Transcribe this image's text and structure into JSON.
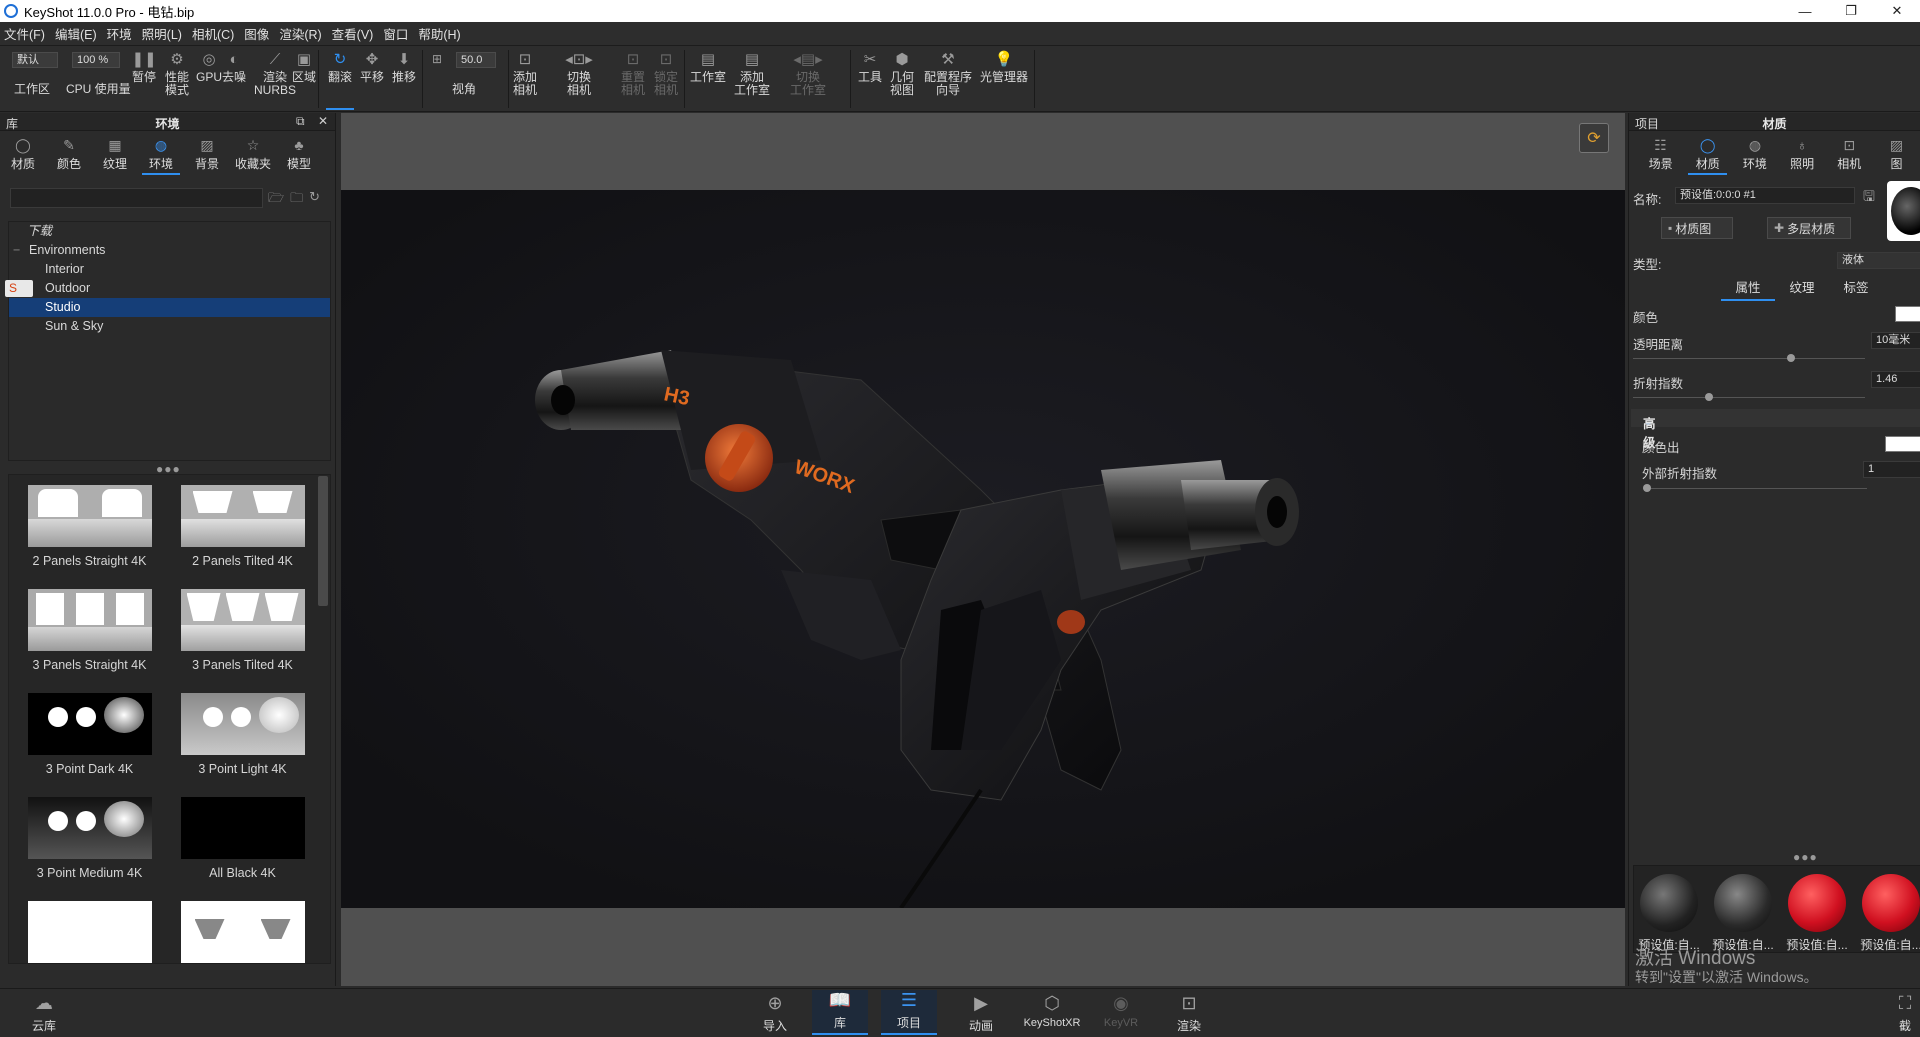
{
  "titlebar": {
    "title": "KeyShot 11.0.0 Pro  - 电钻.bip",
    "minimize": "—",
    "restore": "❐",
    "close": "✕"
  },
  "menu": [
    "文件(F)",
    "编辑(E)",
    "环境",
    "照明(L)",
    "相机(C)",
    "图像",
    "渲染(R)",
    "查看(V)",
    "窗口",
    "帮助(H)"
  ],
  "toolbar": {
    "workspace_select": "默认",
    "workspace_label": "工作区",
    "cpu_value": "100 %",
    "cpu_label": "CPU 使用量",
    "pause_label": "暂停",
    "perf_label": "性能\n模式",
    "gpu_label": "GPU",
    "denoise_label": "去噪",
    "nurbs_label": "渲染\nNURBS",
    "region_label": "区域",
    "tumble_label": "翻滚",
    "pan_label": "平移",
    "dolly_label": "推移",
    "fov_value": "50.0",
    "fov_label": "视角",
    "add_camera_label": "添加\n相机",
    "switch_camera_label": "切换\n相机",
    "reset_camera_label": "重置\n相机",
    "lock_camera_label": "锁定\n相机",
    "studio_label": "工作室",
    "add_studio_label": "添加\n工作室",
    "switch_studio_label": "切换\n工作室",
    "tools_label": "工具",
    "geometry_view_label": "几何\n视图",
    "config_wizard_label": "配置程序\n向导",
    "light_manager_label": "光管理器"
  },
  "library": {
    "panel_title": "库",
    "section_title": "环境",
    "tabs": [
      "材质",
      "颜色",
      "纹理",
      "环境",
      "背景",
      "收藏夹",
      "模型"
    ],
    "active_tab": "环境",
    "search_placeholder": "",
    "tree": [
      {
        "label": "下载",
        "level": 1,
        "italic": true
      },
      {
        "label": "Environments",
        "level": 1
      },
      {
        "label": "Interior",
        "level": 2
      },
      {
        "label": "Outdoor",
        "level": 2
      },
      {
        "label": "Studio",
        "level": 2,
        "selected": true
      },
      {
        "label": "Sun & Sky",
        "level": 2
      }
    ],
    "thumbnails": [
      "2 Panels Straight 4K",
      "2 Panels Tilted 4K",
      "3 Panels Straight 4K",
      "3 Panels Tilted 4K",
      "3 Point Dark 4K",
      "3 Point Light 4K",
      "3 Point Medium 4K",
      "All Black 4K",
      "",
      ""
    ]
  },
  "project": {
    "panel_title": "项目",
    "section_title": "材质",
    "tabs": [
      "场景",
      "材质",
      "环境",
      "照明",
      "相机",
      "图"
    ],
    "active_tab": "材质",
    "name_label": "名称:",
    "name_value": "预设值:0:0:0 #1",
    "material_graph_btn": "材质图",
    "multi_material_btn": "多层材质",
    "type_label": "类型:",
    "type_value": "液体",
    "subtabs": [
      "属性",
      "纹理",
      "标签"
    ],
    "active_subtab": "属性",
    "color_label": "颜色",
    "transparency_distance_label": "透明距离",
    "transparency_distance_value": "10毫米",
    "ior_label": "折射指数",
    "ior_value": "1.46",
    "advanced_label": "高级",
    "color_out_label": "颜色出",
    "outside_ior_label": "外部折射指数",
    "outside_ior_value": "1",
    "material_balls": [
      "预设值:自...",
      "预设值:自...",
      "预设值:自...",
      "预设值:自..."
    ],
    "watermark_line1": "激活 Windows",
    "watermark_line2": "转到\"设置\"以激活 Windows。"
  },
  "bottombar": {
    "cloud_label": "云库",
    "items": [
      "导入",
      "库",
      "项目",
      "动画",
      "KeyShotXR",
      "KeyVR",
      "渲染"
    ],
    "right_label": "截"
  },
  "viewport": {
    "brand_text": "WORX",
    "model_text": "H3"
  }
}
